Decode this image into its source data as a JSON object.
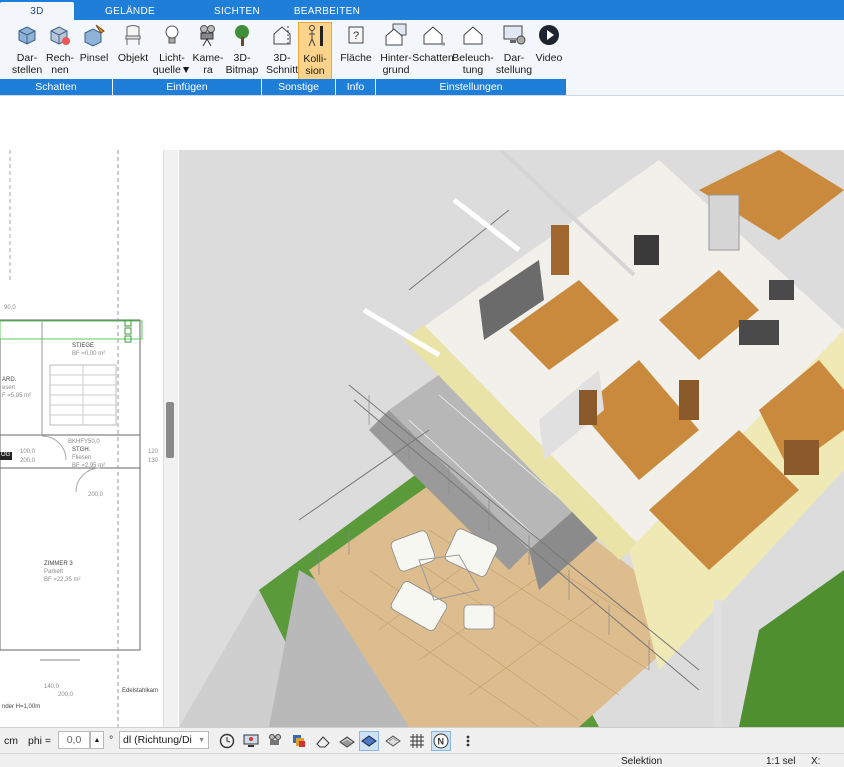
{
  "tabs": [
    "3D",
    "GELÄNDE",
    "SICHTEN",
    "BEARBEITEN"
  ],
  "ribbon": {
    "buttons": [
      {
        "l1": "Dar-",
        "l2": "stellen",
        "icon": "cube-render-icon"
      },
      {
        "l1": "Rech-",
        "l2": "nen",
        "icon": "cube-calculate-icon"
      },
      {
        "l1": "Pinsel",
        "l2": "",
        "icon": "cube-brush-icon"
      },
      {
        "l1": "Objekt",
        "l2": "",
        "icon": "chair-icon"
      },
      {
        "l1": "Licht-",
        "l2": "quelle",
        "icon": "bulb-icon"
      },
      {
        "l1": "Kame-",
        "l2": "ra",
        "icon": "camera-icon"
      },
      {
        "l1": "3D-",
        "l2": "Bitmap",
        "icon": "tree-icon"
      },
      {
        "l1": "3D-",
        "l2": "Schnitt",
        "icon": "section-house-icon"
      },
      {
        "l1": "Kolli-",
        "l2": "sion",
        "icon": "collision-person-icon"
      },
      {
        "l1": "Fläche",
        "l2": "",
        "icon": "area-info-icon"
      },
      {
        "l1": "Hinter-",
        "l2": "grund",
        "icon": "house-background-icon"
      },
      {
        "l1": "Schatten",
        "l2": "",
        "icon": "house-shadow-icon"
      },
      {
        "l1": "Beleuch-",
        "l2": "tung",
        "icon": "house-light-icon"
      },
      {
        "l1": "Dar-",
        "l2": "stellung",
        "icon": "display-settings-icon"
      },
      {
        "l1": "Video",
        "l2": "",
        "icon": "play-video-icon"
      }
    ],
    "groups": [
      "Schatten",
      "Einfügen",
      "Sonstige",
      "Info",
      "Einstellungen"
    ]
  },
  "plan": {
    "labels": [
      "90,0",
      "STIEGE",
      "BF =0,00 m²",
      "ARD.",
      "esen",
      "F =5,85 m²",
      "BKHFY50,0",
      "STGH.",
      "Fliesen",
      "BF =2,95 m²",
      "100,0",
      "200,0",
      "OG",
      "120",
      "130",
      "200,0",
      "ZIMMER 3",
      "Parkett",
      "BF =22,35 m²",
      "140,0",
      "200,0",
      "Edelstahlkam",
      "nder H=1,00m"
    ]
  },
  "toolbar": {
    "unit": "cm",
    "phi_label": "phi =",
    "phi_value": "0,0",
    "degree": "°",
    "direction": "dl (Richtung/Di"
  },
  "status": {
    "mode": "Selektion",
    "scale": "1:1 sel",
    "coord": "X:"
  },
  "colors": {
    "accent": "#1f7fd8",
    "selected_button": "#fbd38a",
    "floor_wood": "#c98a3d",
    "wall": "#f2f0ea",
    "glass": "#e9e3a8",
    "terrace": "#ddbc8e",
    "grass": "#5a9a3a"
  }
}
